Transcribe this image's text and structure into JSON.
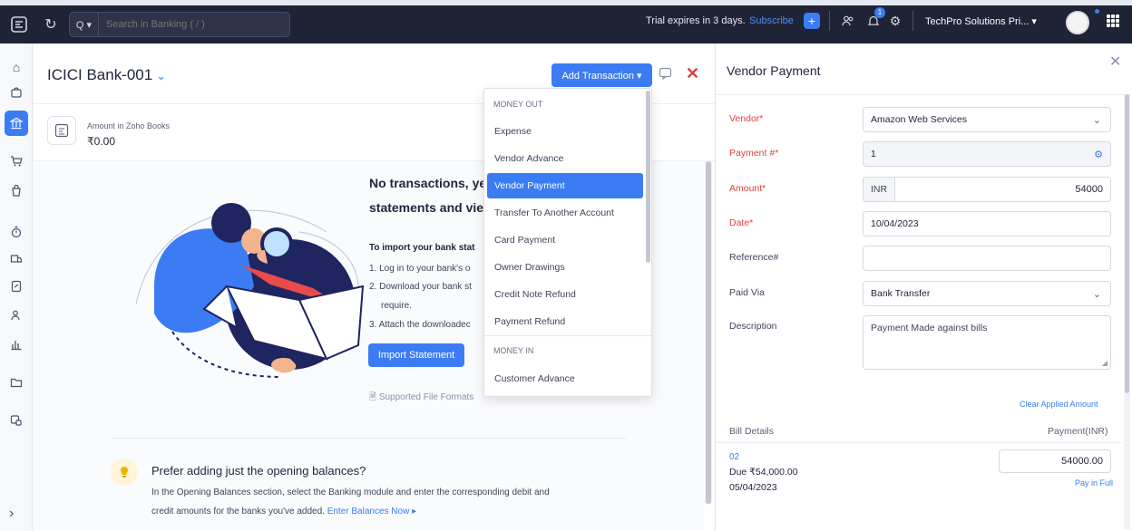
{
  "topbar": {
    "search_placeholder": "Search in Banking ( / )",
    "search_filter_label": "Q ▾",
    "trial_text": "Trial expires in 3 days.",
    "subscribe_label": "Subscribe",
    "notification_count": "1",
    "org_name": "TechPro Solutions Pri... ▾"
  },
  "account": {
    "title": "ICICI Bank-001",
    "add_transaction_label": "Add Transaction ▾",
    "amount_label": "Amount in Zoho Books",
    "amount_value": "₹0.00"
  },
  "empty_state": {
    "heading_line1": "No transactions, ye",
    "heading_line2": "statements and vie",
    "import_title": "To import your bank stat",
    "steps": [
      "1. Log in to your bank's o",
      "2. Download your bank st",
      "require.",
      "3. Attach the downloadec"
    ],
    "import_button": "Import Statement",
    "supported_formats": "Supported File Formats"
  },
  "opening_balance": {
    "title": "Prefer adding just the opening balances?",
    "desc_line1": "In the Opening Balances section, select the Banking module and enter the corresponding debit and",
    "desc_line2": "credit amounts for the banks you've added.",
    "link": "Enter Balances Now ▸"
  },
  "dropdown": {
    "money_out_header": "MONEY OUT",
    "money_out_items": [
      "Expense",
      "Vendor Advance",
      "Vendor Payment",
      "Transfer To Another Account",
      "Card Payment",
      "Owner Drawings",
      "Credit Note Refund",
      "Payment Refund"
    ],
    "selected": "Vendor Payment",
    "money_in_header": "MONEY IN",
    "money_in_items": [
      "Customer Advance"
    ]
  },
  "panel": {
    "title": "Vendor Payment",
    "vendor_label": "Vendor*",
    "vendor_value": "Amazon Web Services",
    "payment_no_label": "Payment #*",
    "payment_no_value": "1",
    "amount_label": "Amount*",
    "currency": "INR",
    "amount_value": "54000",
    "date_label": "Date*",
    "date_value": "10/04/2023",
    "reference_label": "Reference#",
    "reference_value": "",
    "paid_via_label": "Paid Via",
    "paid_via_value": "Bank Transfer",
    "description_label": "Description",
    "description_value": "Payment Made against bills",
    "clear_applied": "Clear Applied Amount",
    "bill_details_header": "Bill Details",
    "payment_header": "Payment(INR)",
    "bill": {
      "number": "02",
      "due": "Due ₹54,000.00",
      "date": "05/04/2023",
      "payment": "54000.00",
      "pay_in_full": "Pay in Full"
    }
  },
  "colors": {
    "accent": "#3b7cf5",
    "topbar_bg": "#1f2336",
    "required_label": "#e0403a"
  }
}
